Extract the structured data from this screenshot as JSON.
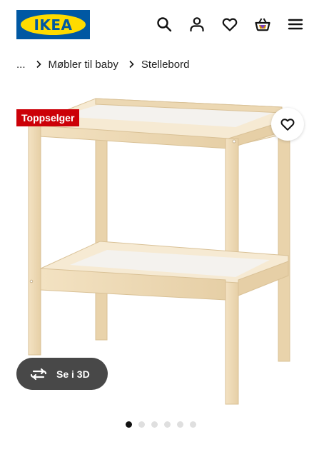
{
  "header": {
    "logo_text": "IKEA",
    "icons": [
      "search-icon",
      "account-icon",
      "heart-icon",
      "basket-icon",
      "menu-icon"
    ]
  },
  "breadcrumb": {
    "items": [
      "...",
      "Møbler til baby",
      "Stellebord"
    ]
  },
  "product": {
    "badge": "Toppselger",
    "view_3d_label": "Se i 3D",
    "carousel": {
      "total": 6,
      "active": 1
    }
  },
  "colors": {
    "ikea_blue": "#0058a3",
    "ikea_yellow": "#ffdb00",
    "badge_red": "#cc0008",
    "button_dark": "#484848",
    "wood": "#eed9b4"
  }
}
